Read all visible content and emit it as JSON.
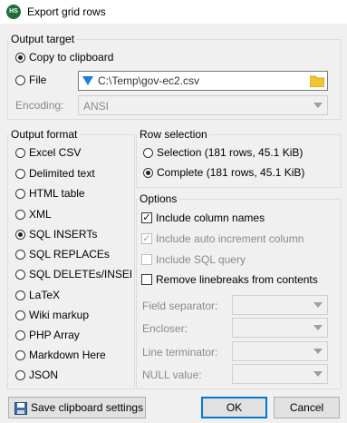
{
  "window": {
    "title": "Export grid rows",
    "icon_text": "HS"
  },
  "output_target": {
    "legend": "Output target",
    "copy_label": "Copy to clipboard",
    "file_label": "File",
    "file_path": "C:\\Temp\\gov-ec2.csv",
    "encoding_label": "Encoding:",
    "encoding_value": "ANSI",
    "selected": "copy"
  },
  "output_format": {
    "legend": "Output format",
    "options": [
      "Excel CSV",
      "Delimited text",
      "HTML table",
      "XML",
      "SQL INSERTs",
      "SQL REPLACEs",
      "SQL DELETEs/INSERT",
      "LaTeX",
      "Wiki markup",
      "PHP Array",
      "Markdown Here",
      "JSON"
    ],
    "selected": "SQL INSERTs"
  },
  "row_selection": {
    "legend": "Row selection",
    "selection_label": "Selection (181 rows, 45.1 KiB)",
    "complete_label": "Complete (181 rows, 45.1 KiB)",
    "selected": "complete"
  },
  "options": {
    "legend": "Options",
    "include_column_names": {
      "label": "Include column names",
      "checked": true,
      "enabled": true
    },
    "include_auto_increment": {
      "label": "Include auto increment column",
      "checked": true,
      "enabled": false
    },
    "include_sql_query": {
      "label": "Include SQL query",
      "checked": false,
      "enabled": false
    },
    "remove_linebreaks": {
      "label": "Remove linebreaks from contents",
      "checked": false,
      "enabled": true
    },
    "field_separator_label": "Field separator:",
    "encloser_label": "Encloser:",
    "line_terminator_label": "Line terminator:",
    "null_value_label": "NULL value:"
  },
  "buttons": {
    "save_clipboard": "Save clipboard settings",
    "ok": "OK",
    "cancel": "Cancel"
  },
  "colors": {
    "folder": "#f4c430",
    "file_icon": "#1e7be0",
    "default_button_border": "#0078d7"
  }
}
